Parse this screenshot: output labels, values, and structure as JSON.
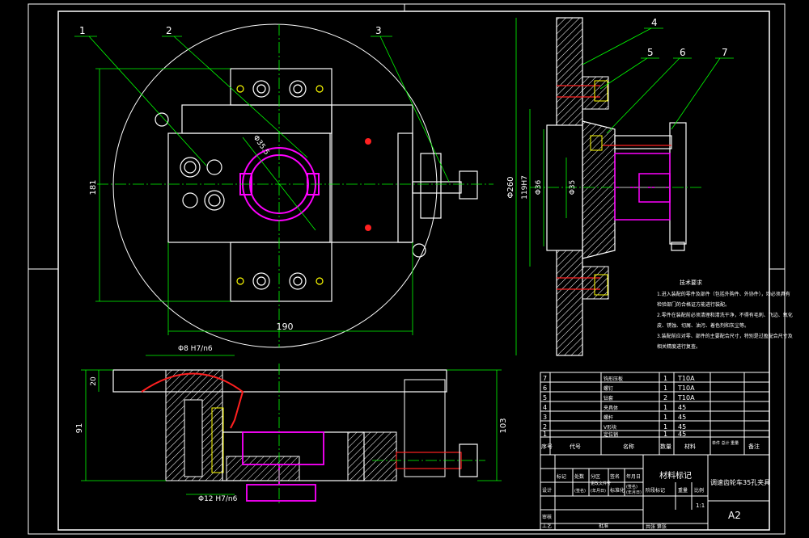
{
  "drawing": {
    "sheet_size": "A2",
    "title": "调速齿轮车35孔夹具",
    "material_label": "材料标记",
    "scale": "1:1",
    "sheet_count": "共张 第张"
  },
  "balloons": [
    "1",
    "2",
    "3",
    "4",
    "5",
    "6",
    "7"
  ],
  "dimensions": {
    "top_view_width": "190",
    "top_view_height": "181",
    "bore_dia": "Φ35.5",
    "flange_dia": "Φ260",
    "bore_fit": "119H7",
    "pilot_dia": "Φ36",
    "inner_dia": "Φ35",
    "pin_dia_top": "Φ8 H7/n6",
    "pin_dia_bottom": "Φ12 H7/n6",
    "front_height": "91",
    "front_thickness": "20",
    "front_total": "103"
  },
  "notes": {
    "title": "技术要求",
    "lines": [
      "1.进入装配的零件及部件（包括外购件、外协件），均必须具有",
      "检验部门的合格证方能进行装配。",
      "2.零件在装配前必须清理和清洗干净，不得有毛刺、飞边、氧化",
      "皮、锈蚀、切屑、油污、着色剂和灰尘等。",
      "3.装配前应对零、部件的主要配合尺寸，特别是过盈配合尺寸及",
      "相关精度进行复查。"
    ]
  },
  "bom": {
    "headers": [
      "序号",
      "代号",
      "名称",
      "数量",
      "材料",
      "单件 总计 重量",
      "备注"
    ],
    "rows": [
      {
        "no": "7",
        "name": "钩形压板",
        "qty": "1",
        "material": "T10A"
      },
      {
        "no": "6",
        "name": "螺钉",
        "qty": "1",
        "material": "T10A"
      },
      {
        "no": "5",
        "name": "钻套",
        "qty": "2",
        "material": "T10A"
      },
      {
        "no": "4",
        "name": "夹具体",
        "qty": "1",
        "material": "45"
      },
      {
        "no": "3",
        "name": "螺杆",
        "qty": "1",
        "material": "45"
      },
      {
        "no": "2",
        "name": "V形块",
        "qty": "1",
        "material": "45"
      },
      {
        "no": "1",
        "name": "定位销",
        "qty": "1",
        "material": "45"
      }
    ]
  },
  "title_block": {
    "row1": [
      "标记",
      "处数",
      "分区",
      "更改文件号",
      "签名",
      "年月日"
    ],
    "row2": [
      "设计",
      "(签名)",
      "(年月日)",
      "标准化",
      "(签名)",
      "(年月日)"
    ],
    "row3": [
      "审核"
    ],
    "row4": [
      "工艺",
      "批准"
    ],
    "stage": "阶段标记",
    "weight": "重量",
    "ratio": "比例"
  },
  "colors": {
    "outline": "#ffffff",
    "dim": "#00ff00",
    "center": "#00ff00",
    "magenta": "#ff00ff",
    "red": "#ff2020",
    "yellow": "#ffff00"
  }
}
